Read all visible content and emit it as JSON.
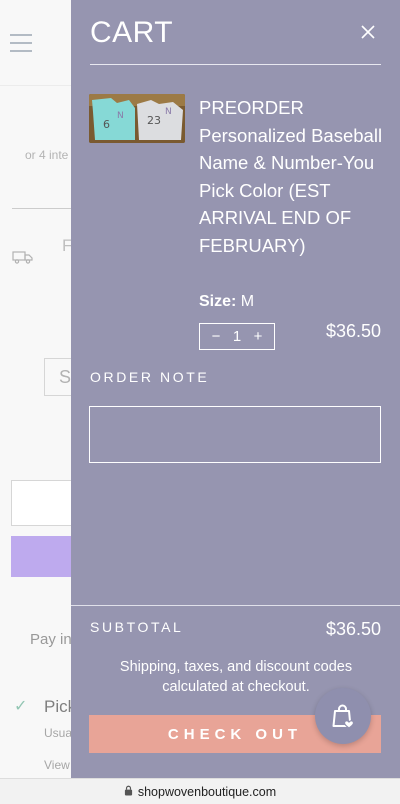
{
  "background": {
    "installments_text": "or 4 inte",
    "shipping_letter": "F",
    "select_letter": "S",
    "pay_in_text": "Pay in",
    "pickup_title": "Pick",
    "pickup_sub": "Usua",
    "pickup_view": "View",
    "accent_purple": "#a98ee8"
  },
  "cart": {
    "title": "CART",
    "close_icon": "close-icon",
    "item": {
      "name": "PREORDER Personalized Baseball Name & Number-You Pick Color (EST ARRIVAL END OF FEBRUARY)",
      "variant_label": "Size:",
      "variant_value": "M",
      "quantity": "1",
      "decrement": "−",
      "increment": "+",
      "price": "$36.50"
    },
    "order_note_label": "ORDER NOTE",
    "order_note_value": "",
    "subtotal_label": "SUBTOTAL",
    "subtotal_value": "$36.50",
    "shipping_note": "Shipping, taxes, and discount codes calculated at checkout.",
    "checkout_label": "CHECK OUT",
    "colors": {
      "drawer": "#9695b0",
      "checkout": "#e8a497"
    }
  },
  "browser": {
    "url": "shopwovenboutique.com"
  }
}
